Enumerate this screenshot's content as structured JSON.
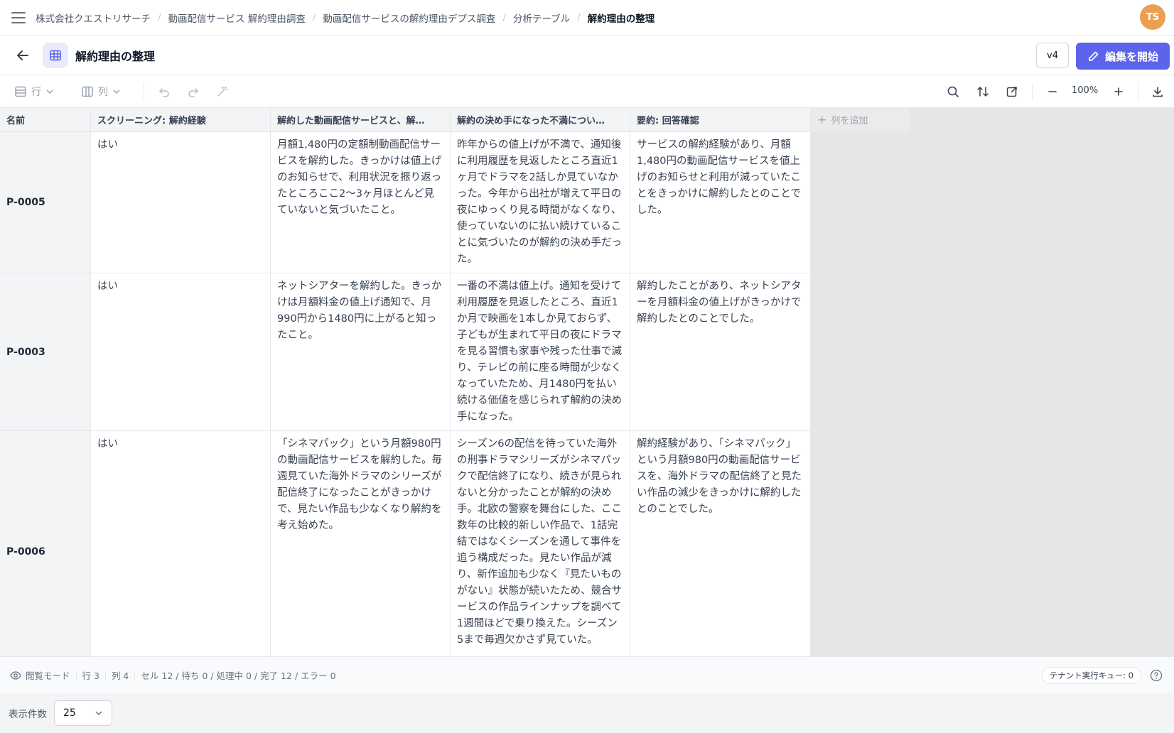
{
  "nav": {
    "breadcrumbs": [
      "株式会社クエストリサーチ",
      "動画配信サービス 解約理由調査",
      "動画配信サービスの解約理由デプス調査",
      "分析テーブル",
      "解約理由の整理"
    ],
    "avatar_initials": "TS",
    "avatar_color": "#e9a054"
  },
  "header": {
    "title": "解約理由の整理",
    "version": "v4",
    "edit_label": "編集を開始",
    "accent_color": "#5b64eb"
  },
  "toolbar": {
    "row_label": "行",
    "column_label": "列",
    "zoom": "100%"
  },
  "table": {
    "columns": [
      "名前",
      "スクリーニング: 解約経験",
      "解約した動画配信サービスと、解…",
      "解約の決め手になった不満につい…",
      "要約: 回答確認"
    ],
    "add_column_label": "列を追加",
    "rows": [
      {
        "name": "P-0005",
        "screening": "はい",
        "service": "月額1,480円の定額制動画配信サービスを解約した。きっかけは値上げのお知らせで、利用状況を振り返ったところここ2〜3ヶ月ほとんど見ていないと気づいたこと。",
        "reason": "昨年からの値上げが不満で、通知後に利用履歴を見返したところ直近1ヶ月でドラマを2話しか見ていなかった。今年から出社が増えて平日の夜にゆっくり見る時間がなくなり、使っていないのに払い続けていることに気づいたのが解約の決め手だった。",
        "summary": "サービスの解約経験があり、月額1,480円の動画配信サービスを値上げのお知らせと利用が減っていたことをきっかけに解約したとのことでした。"
      },
      {
        "name": "P-0003",
        "screening": "はい",
        "service": "ネットシアターを解約した。きっかけは月額料金の値上げ通知で、月990円から1480円に上がると知ったこと。",
        "reason": "一番の不満は値上げ。通知を受けて利用履歴を見返したところ、直近1か月で映画を1本しか見ておらず、子どもが生まれて平日の夜にドラマを見る習慣も家事や残った仕事で減り、テレビの前に座る時間が少なくなっていたため、月1480円を払い続ける価値を感じられず解約の決め手になった。",
        "summary": "解約したことがあり、ネットシアターを月額料金の値上げがきっかけで解約したとのことでした。"
      },
      {
        "name": "P-0006",
        "screening": "はい",
        "service": "「シネマパック」という月額980円の動画配信サービスを解約した。毎週見ていた海外ドラマのシリーズが配信終了になったことがきっかけで、見たい作品も少なくなり解約を考え始めた。",
        "reason": "シーズン6の配信を待っていた海外の刑事ドラマシリーズがシネマパックで配信終了になり、続きが見られないと分かったことが解約の決め手。北欧の警察を舞台にした、ここ数年の比較的新しい作品で、1話完結ではなくシーズンを通して事件を追う構成だった。見たい作品が減り、新作追加も少なく『見たいものがない』状態が続いたため、競合サービスの作品ラインナップを調べて1週間ほどで乗り換えた。シーズン5まで毎週欠かさず見ていた。",
        "summary": "解約経験があり、「シネマパック」という月額980円の動画配信サービスを、海外ドラマの配信終了と見たい作品の減少をきっかけに解約したとのことでした。"
      }
    ]
  },
  "status": {
    "mode": "閲覧モード",
    "rows": "行 3",
    "cols": "列 4",
    "cells": "セル 12 / 待ち 0 / 処理中 0 / 完了 12 / エラー 0",
    "queue": "テナント実行キュー: 0"
  },
  "pager": {
    "label": "表示件数",
    "value": "25"
  }
}
